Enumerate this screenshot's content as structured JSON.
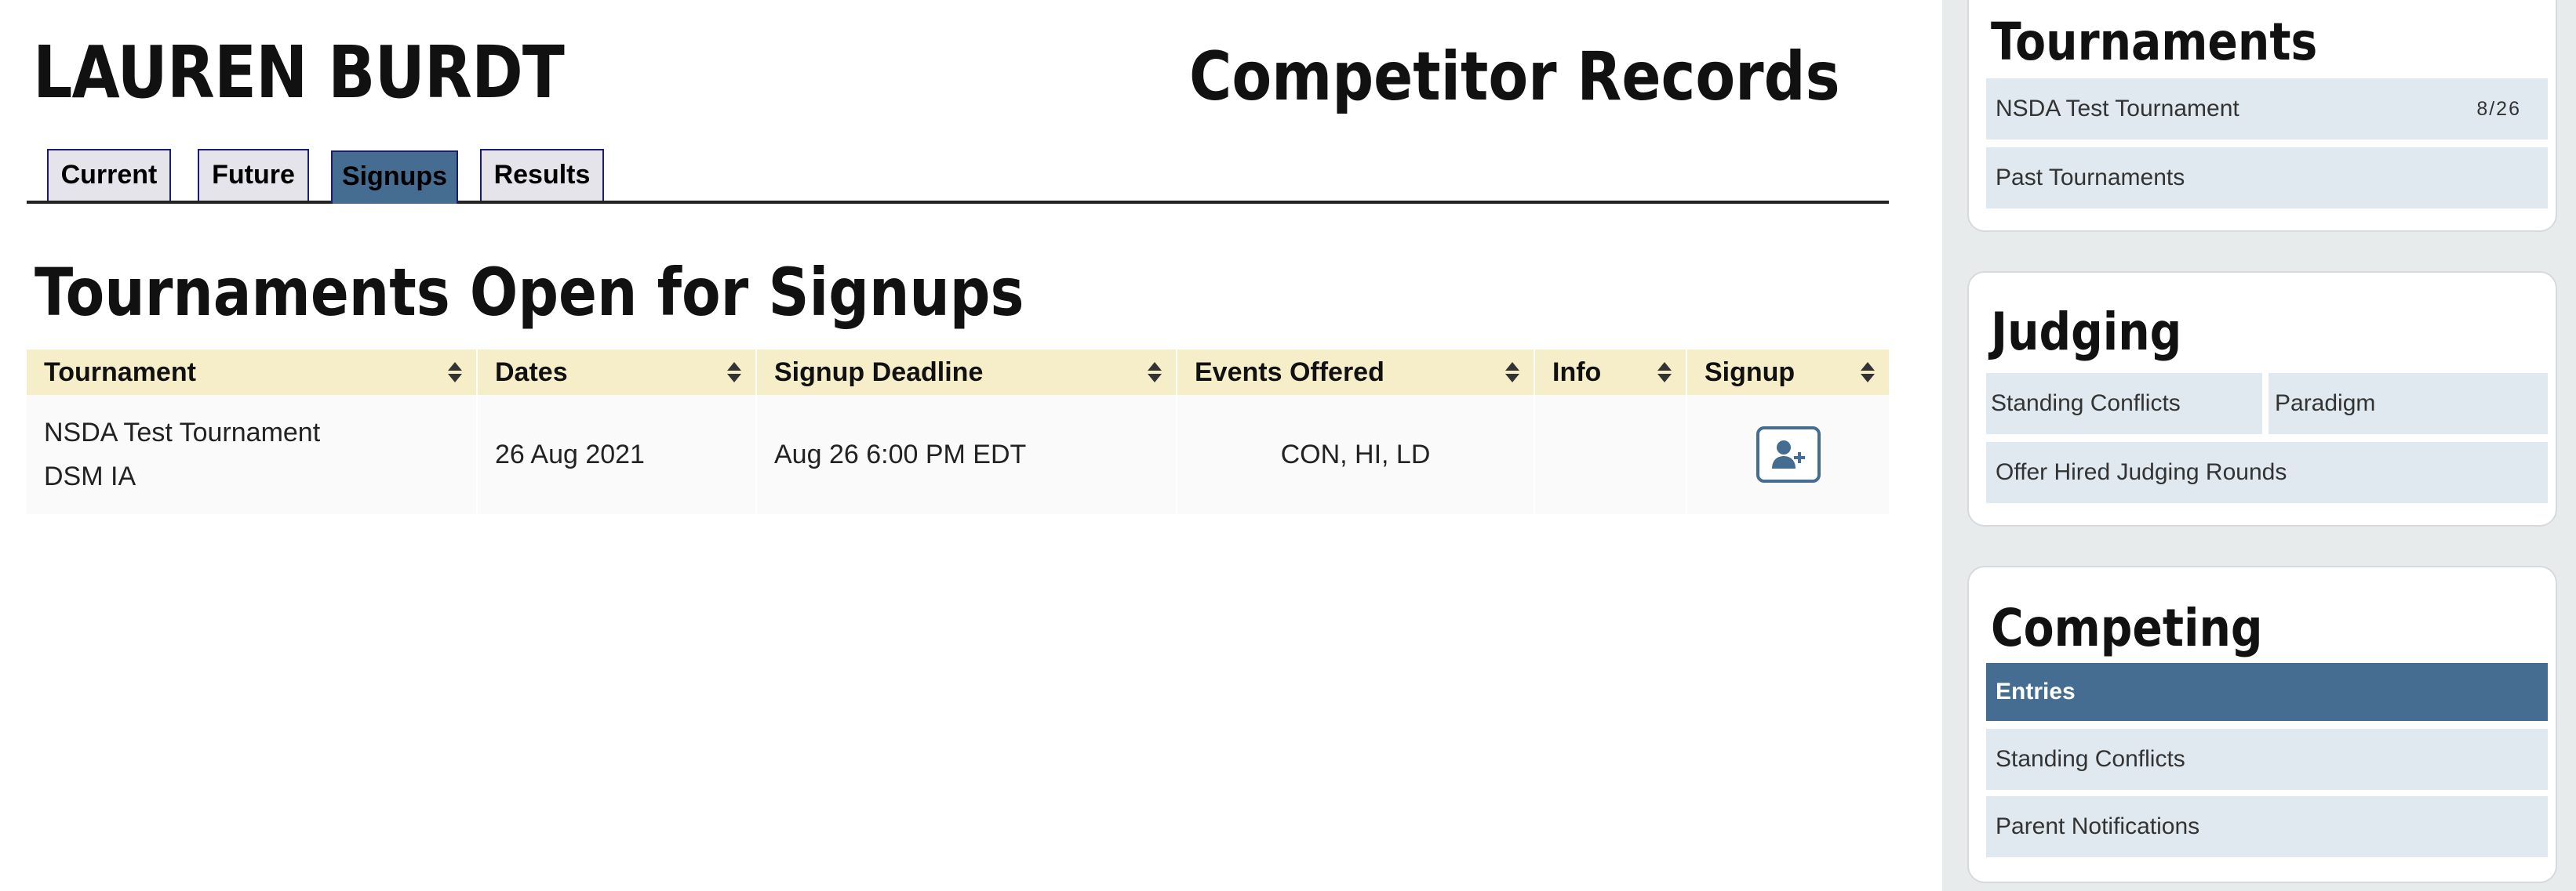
{
  "header": {
    "person_name": "LAUREN BURDT",
    "page_title": "Competitor Records"
  },
  "tabs": [
    {
      "label": "Current",
      "active": false
    },
    {
      "label": "Future",
      "active": false
    },
    {
      "label": "Signups",
      "active": true
    },
    {
      "label": "Results",
      "active": false
    }
  ],
  "section_title": "Tournaments Open for Signups",
  "table": {
    "columns": [
      "Tournament",
      "Dates",
      "Signup Deadline",
      "Events Offered",
      "Info",
      "Signup"
    ],
    "rows": [
      {
        "tournament": "NSDA Test Tournament",
        "location": "DSM IA",
        "dates": "26 Aug 2021",
        "deadline": "Aug 26 6:00 PM EDT",
        "events": "CON, HI, LD",
        "info": "",
        "signup_icon": "user-plus-icon"
      }
    ]
  },
  "sidebar": {
    "tournaments": {
      "title": "Tournaments",
      "links": [
        {
          "label": "NSDA Test Tournament",
          "count": "8/26"
        },
        {
          "label": "Past Tournaments"
        }
      ]
    },
    "judging": {
      "title": "Judging",
      "links": [
        {
          "label": "Standing Conflicts"
        },
        {
          "label": "Paradigm"
        },
        {
          "label": "Offer Hired Judging Rounds"
        }
      ]
    },
    "competing": {
      "title": "Competing",
      "links": [
        {
          "label": "Entries",
          "active": true
        },
        {
          "label": "Standing Conflicts"
        },
        {
          "label": "Parent Notifications"
        }
      ]
    }
  },
  "colors": {
    "accent": "#456d91",
    "table_header_bg": "#f6eec9",
    "sidebar_bg": "#e8ebec",
    "sidebar_link_bg": "#dfe9ef",
    "tab_border": "#1d1e6a"
  }
}
